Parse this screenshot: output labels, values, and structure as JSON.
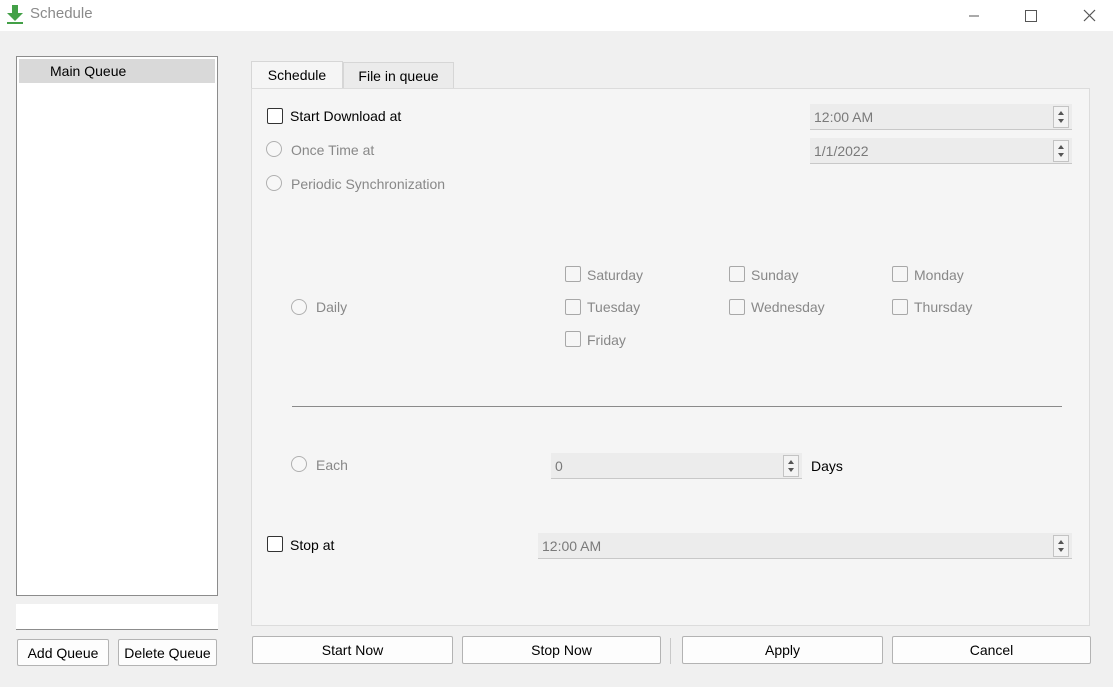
{
  "window": {
    "title": "Schedule",
    "accent": "#4caf50"
  },
  "queues": {
    "items": [
      "Main Queue"
    ],
    "selected": "Main Queue",
    "name_input": "",
    "add_label": "Add Queue",
    "delete_label": "Delete Queue"
  },
  "tabs": [
    "Schedule",
    "File in queue"
  ],
  "schedule": {
    "start_download_label": "Start Download at",
    "start_time": "12:00 AM",
    "once_time_label": "Once Time at",
    "once_date": "1/1/2022",
    "periodic_label": "Periodic Synchronization",
    "daily_label": "Daily",
    "days": [
      "Saturday",
      "Sunday",
      "Monday",
      "Tuesday",
      "Wednesday",
      "Thursday",
      "Friday"
    ],
    "each_label": "Each",
    "each_value": "0",
    "days_unit": "Days",
    "stop_at_label": "Stop at",
    "stop_time": "12:00 AM"
  },
  "actions": {
    "start_now": "Start Now",
    "stop_now": "Stop Now",
    "apply": "Apply",
    "cancel": "Cancel"
  }
}
